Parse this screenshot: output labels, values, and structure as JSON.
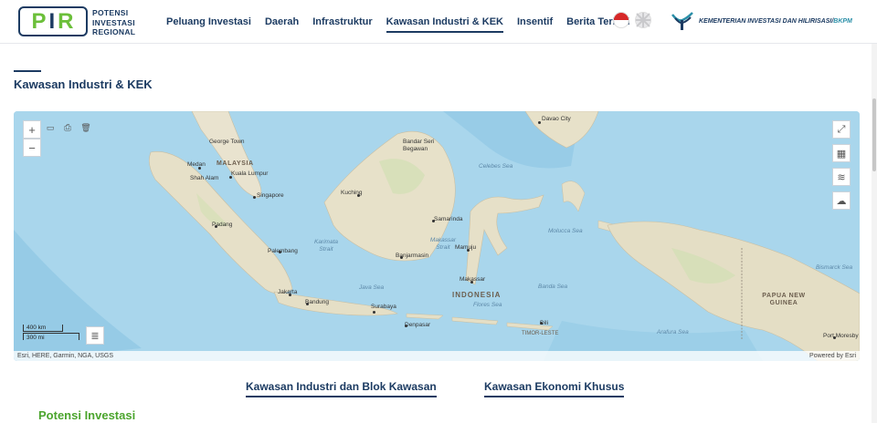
{
  "header": {
    "logo": {
      "p": "P",
      "i": "I",
      "r": "R"
    },
    "logo_text": [
      "POTENSI",
      "INVESTASI",
      "REGIONAL"
    ],
    "nav": [
      {
        "label": "Peluang Investasi",
        "active": false
      },
      {
        "label": "Daerah",
        "active": false
      },
      {
        "label": "Infrastruktur",
        "active": false
      },
      {
        "label": "Kawasan Industri & KEK",
        "active": true
      },
      {
        "label": "Insentif",
        "active": false
      },
      {
        "label": "Berita Terkini",
        "active": false
      }
    ],
    "ministry_main": "KEMENTERIAN INVESTASI DAN HILIRISASI/",
    "ministry_bkpm": "BKPM"
  },
  "page_title": "Kawasan Industri & KEK",
  "map": {
    "countries": {
      "malaysia": "MALAYSIA",
      "indonesia": "INDONESIA",
      "papua": "PAPUA NEW GUINEA"
    },
    "cities": {
      "davao": "Davao City",
      "george": "George Town",
      "medan": "Medan",
      "kl": "Kuala Lumpur",
      "shah": "Shah Alam",
      "singapore": "Singapore",
      "bandar": "Bandar Seri Begawan",
      "kuching": "Kuching",
      "samarinda": "Samarinda",
      "padang": "Padang",
      "palembang": "Palembang",
      "banjarmasin": "Banjarmasin",
      "mamuju": "Mamuju",
      "makassar": "Makassar",
      "jakarta": "Jakarta",
      "bandung": "Bandung",
      "surabaya": "Surabaya",
      "denpasar": "Denpasar",
      "dili": "Dili",
      "portmoresby": "Port Moresby"
    },
    "seas": {
      "celebes": "Celebes Sea",
      "molucca": "Molucca Sea",
      "karimata": "Karimata Strait",
      "makassar_strait": "Makassar Strait",
      "java": "Java Sea",
      "banda": "Banda Sea",
      "flores": "Flores Sea",
      "arafura": "Arafura Sea",
      "bismarck": "Bismarck Sea",
      "timor": "TIMOR-LESTE"
    },
    "scale": {
      "km": "400 km",
      "mi": "300 mi"
    },
    "attribution": "Esri, HERE, Garmin, NGA, USGS",
    "powered": "Powered by Esri",
    "controls": {
      "zoom_in": "+",
      "zoom_out": "−",
      "measure": "▭",
      "print": "⎙",
      "trash": "🗑",
      "fullscreen": "⤢",
      "qr": "▦",
      "layers": "≋",
      "cloud": "☁",
      "legend": "≣"
    }
  },
  "tabs": [
    {
      "label": "Kawasan Industri dan Blok Kawasan"
    },
    {
      "label": "Kawasan Ekonomi Khusus"
    }
  ],
  "section_heading": "Potensi Investasi"
}
